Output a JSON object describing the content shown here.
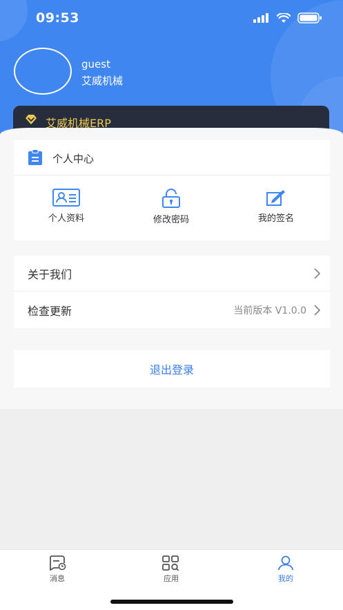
{
  "status_bar": {
    "time": "09:53"
  },
  "user": {
    "name": "guest",
    "company": "艾威机械"
  },
  "erp": {
    "title": "艾威机械ERP"
  },
  "profile_section": {
    "title": "个人中心",
    "actions": [
      {
        "label": "个人资料",
        "icon": "id-card-icon"
      },
      {
        "label": "修改密码",
        "icon": "lock-icon"
      },
      {
        "label": "我的签名",
        "icon": "signature-icon"
      }
    ]
  },
  "menu": {
    "about": {
      "label": "关于我们"
    },
    "update": {
      "label": "检查更新",
      "value": "当前版本 V1.0.0"
    }
  },
  "logout": {
    "label": "退出登录"
  },
  "tabs": [
    {
      "label": "消息",
      "icon": "message-icon"
    },
    {
      "label": "应用",
      "icon": "apps-icon"
    },
    {
      "label": "我的",
      "icon": "profile-icon"
    }
  ],
  "colors": {
    "header": "#3f86f1",
    "accent": "#3a7de6",
    "erp_card": "#262e3e",
    "erp_text": "#f0c84f"
  }
}
